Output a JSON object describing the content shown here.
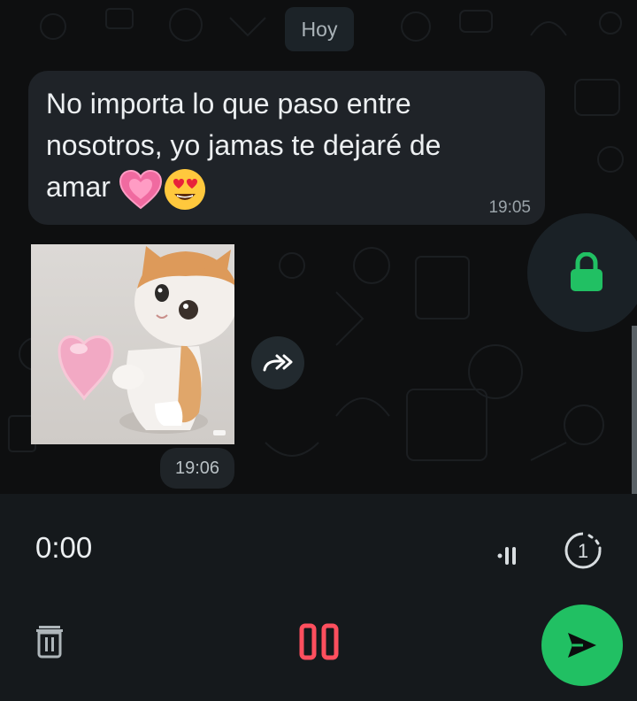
{
  "chat": {
    "date_chip": "Hoy",
    "messages": [
      {
        "text": "No importa lo que paso entre\nnosotros, yo jamas te dejaré de\namar",
        "emojis": [
          "growing-heart-emoji",
          "heart-eyes-emoji"
        ],
        "time": "19:05",
        "direction": "incoming"
      },
      {
        "type": "sticker",
        "sticker": "kitten-holding-pink-heart",
        "time": "19:06",
        "direction": "incoming"
      }
    ],
    "forward_icon": "forward-icon",
    "lock_icon": "lock-icon"
  },
  "recorder": {
    "elapsed": "0:00",
    "icons": {
      "waveform": "waveform-icon",
      "view_once": "view-once-icon",
      "delete": "trash-icon",
      "pause": "pause-icon",
      "send": "send-icon"
    },
    "view_once_label": "1"
  },
  "colors": {
    "accent": "#21c063",
    "pause": "#ff4f5e",
    "bubble": "#1f2328",
    "background": "#0e0f10"
  }
}
